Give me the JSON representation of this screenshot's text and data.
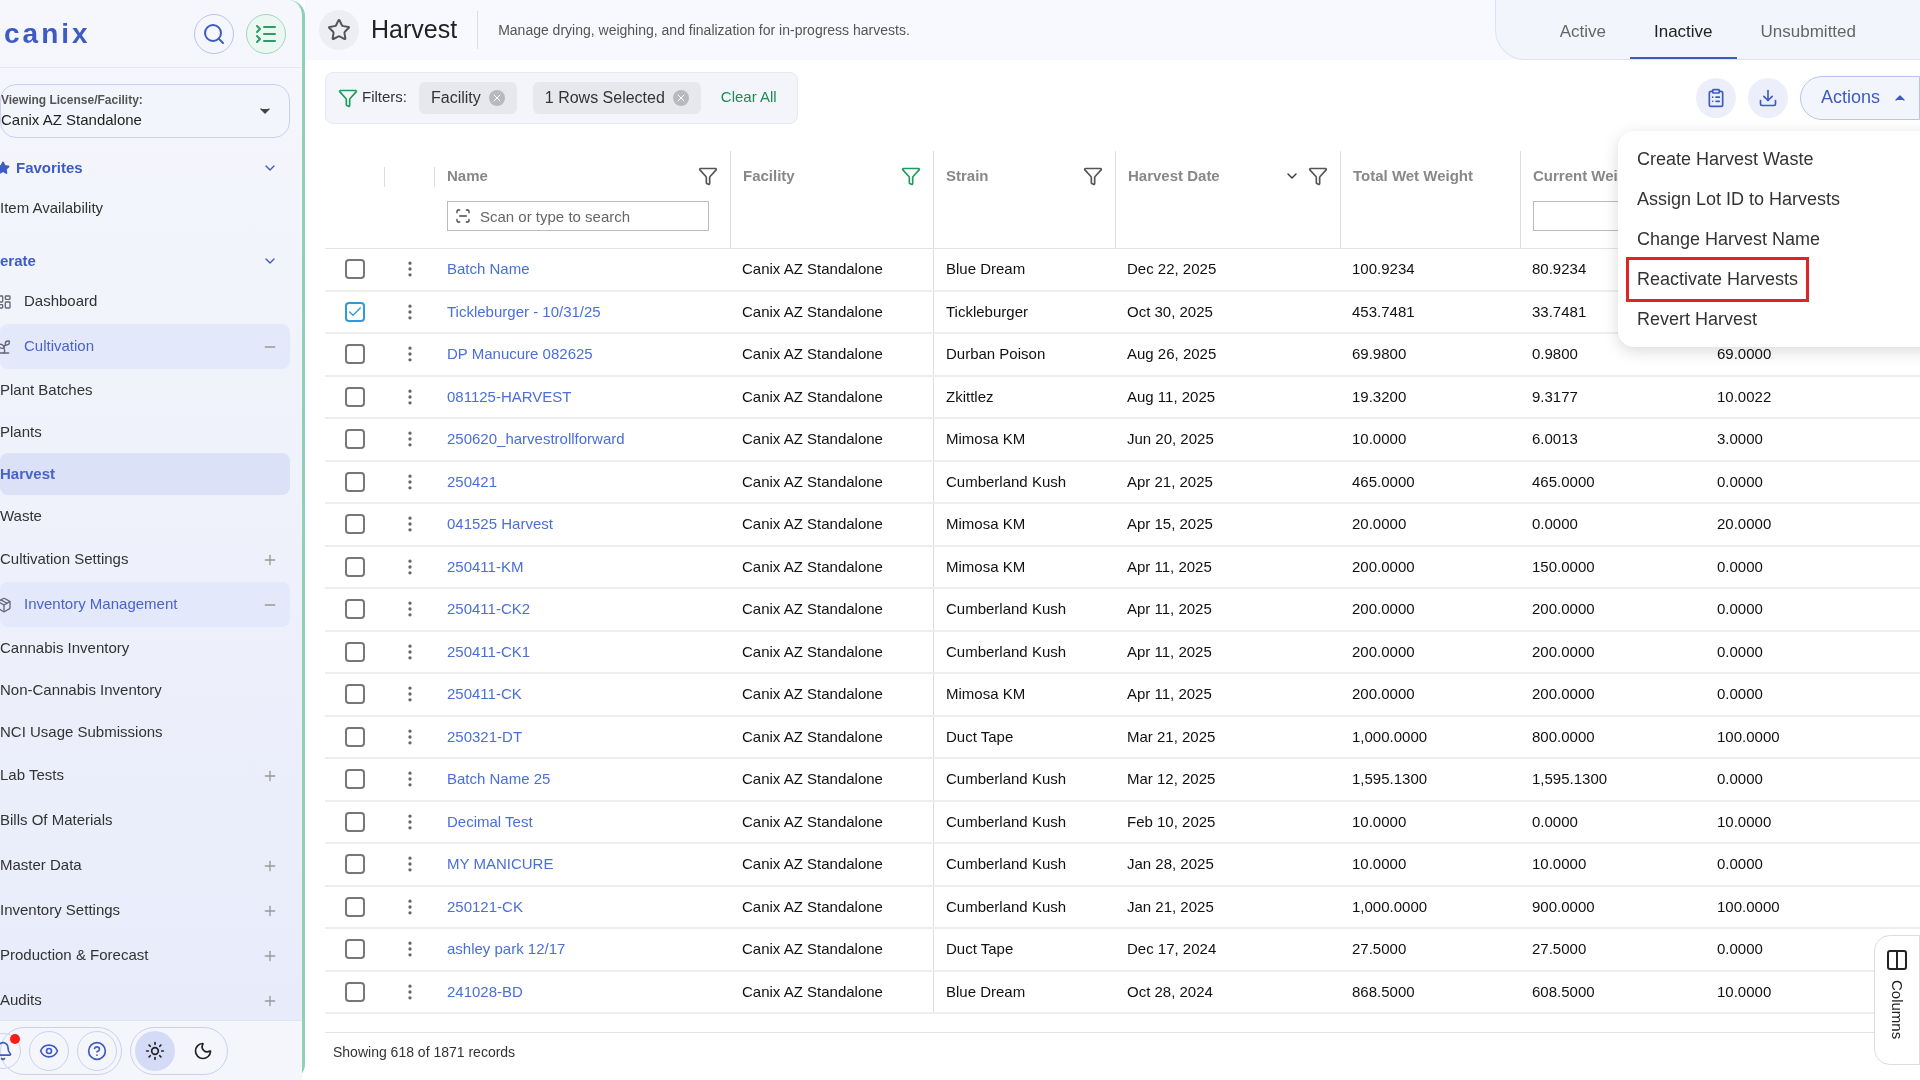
{
  "sidebar": {
    "logo": "canix",
    "license": {
      "label": "Viewing License/Facility:",
      "value": "Canix AZ Standalone"
    },
    "sections": [
      {
        "title": "Favorites",
        "expanded": true,
        "items": [
          {
            "label": "Item Availability",
            "kind": "plain"
          }
        ]
      },
      {
        "title": "erate",
        "expanded": true,
        "items": [
          {
            "label": "Dashboard",
            "kind": "link"
          },
          {
            "label": "Cultivation",
            "kind": "group",
            "expanded": true,
            "children": [
              {
                "label": "Plant Batches",
                "selected": false
              },
              {
                "label": "Plants",
                "selected": false
              },
              {
                "label": "Harvest",
                "selected": true
              },
              {
                "label": "Waste",
                "selected": false
              }
            ]
          },
          {
            "label": "Cultivation Settings",
            "kind": "group",
            "expanded": false
          },
          {
            "label": "Inventory Management",
            "kind": "group",
            "expanded": true,
            "children": [
              {
                "label": "Cannabis Inventory",
                "selected": false
              },
              {
                "label": "Non-Cannabis Inventory",
                "selected": false
              },
              {
                "label": "NCI Usage Submissions",
                "selected": false
              }
            ]
          },
          {
            "label": "Lab Tests",
            "kind": "group",
            "expanded": false
          },
          {
            "label": "Bills Of Materials",
            "kind": "plain"
          },
          {
            "label": "Master Data",
            "kind": "group",
            "expanded": false
          },
          {
            "label": "Inventory Settings",
            "kind": "group",
            "expanded": false
          },
          {
            "label": "Production & Forecast",
            "kind": "group",
            "expanded": false
          },
          {
            "label": "Audits",
            "kind": "group",
            "expanded": false
          }
        ]
      }
    ],
    "footer": {
      "notifications": true,
      "light_mode": true
    }
  },
  "header": {
    "title": "Harvest",
    "subtitle": "Manage drying, weighing, and finalization for in-progress harvests."
  },
  "tabs": [
    {
      "label": "Active",
      "selected": false
    },
    {
      "label": "Inactive",
      "selected": true
    },
    {
      "label": "Unsubmitted",
      "selected": false
    }
  ],
  "filters": {
    "label": "Filters:",
    "chips": [
      "Facility",
      "1 Rows Selected"
    ],
    "clear": "Clear All"
  },
  "actions": {
    "label": "Actions",
    "expanded": true,
    "menu": [
      {
        "label": "Create Harvest Waste",
        "highlighted": false
      },
      {
        "label": "Assign Lot ID to Harvests",
        "highlighted": false
      },
      {
        "label": "Change Harvest Name",
        "highlighted": false
      },
      {
        "label": "Reactivate Harvests",
        "highlighted": true
      },
      {
        "label": "Revert Harvest",
        "highlighted": false
      }
    ]
  },
  "table": {
    "columns": [
      {
        "label": "Name",
        "kind": "filterable",
        "filter_active": false,
        "placeholder": "Scan or type to search"
      },
      {
        "label": "Facility",
        "kind": "filterable",
        "filter_active": true
      },
      {
        "label": "Strain",
        "kind": "filterable",
        "filter_active": false
      },
      {
        "label": "Harvest Date",
        "kind": "sortable",
        "filter_active": false
      },
      {
        "label": "Total Wet Weight",
        "kind": "plain"
      },
      {
        "label": "Current Wei",
        "kind": "input"
      }
    ],
    "rows": [
      {
        "checked": false,
        "cells": [
          "Batch Name",
          "Canix AZ Standalone",
          "Blue Dream",
          "Dec 22, 2025",
          "100.9234",
          "80.9234"
        ]
      },
      {
        "checked": true,
        "cells": [
          "Tickleburger - 10/31/25",
          "Canix AZ Standalone",
          "Tickleburger",
          "Oct 30, 2025",
          "453.7481",
          "33.7481"
        ]
      },
      {
        "checked": false,
        "cells": [
          "DP Manucure 082625",
          "Canix AZ Standalone",
          "Durban Poison",
          "Aug 26, 2025",
          "69.9800",
          "0.9800",
          "69.0000"
        ]
      },
      {
        "checked": false,
        "cells": [
          "081125-HARVEST",
          "Canix AZ Standalone",
          "Zkittlez",
          "Aug 11, 2025",
          "19.3200",
          "9.3177",
          "10.0022"
        ]
      },
      {
        "checked": false,
        "cells": [
          "250620_harvestrollforward",
          "Canix AZ Standalone",
          "Mimosa KM",
          "Jun 20, 2025",
          "10.0000",
          "6.0013",
          "3.0000"
        ]
      },
      {
        "checked": false,
        "cells": [
          "250421",
          "Canix AZ Standalone",
          "Cumberland Kush",
          "Apr 21, 2025",
          "465.0000",
          "465.0000",
          "0.0000"
        ]
      },
      {
        "checked": false,
        "cells": [
          "041525 Harvest",
          "Canix AZ Standalone",
          "Mimosa KM",
          "Apr 15, 2025",
          "20.0000",
          "0.0000",
          "20.0000"
        ]
      },
      {
        "checked": false,
        "cells": [
          "250411-KM",
          "Canix AZ Standalone",
          "Mimosa KM",
          "Apr 11, 2025",
          "200.0000",
          "150.0000",
          "0.0000"
        ]
      },
      {
        "checked": false,
        "cells": [
          "250411-CK2",
          "Canix AZ Standalone",
          "Cumberland Kush",
          "Apr 11, 2025",
          "200.0000",
          "200.0000",
          "0.0000"
        ]
      },
      {
        "checked": false,
        "cells": [
          "250411-CK1",
          "Canix AZ Standalone",
          "Cumberland Kush",
          "Apr 11, 2025",
          "200.0000",
          "200.0000",
          "0.0000"
        ]
      },
      {
        "checked": false,
        "cells": [
          "250411-CK",
          "Canix AZ Standalone",
          "Mimosa KM",
          "Apr 11, 2025",
          "200.0000",
          "200.0000",
          "0.0000"
        ]
      },
      {
        "checked": false,
        "cells": [
          "250321-DT",
          "Canix AZ Standalone",
          "Duct Tape",
          "Mar 21, 2025",
          "1,000.0000",
          "800.0000",
          "100.0000"
        ]
      },
      {
        "checked": false,
        "cells": [
          "Batch Name 25",
          "Canix AZ Standalone",
          "Cumberland Kush",
          "Mar 12, 2025",
          "1,595.1300",
          "1,595.1300",
          "0.0000"
        ]
      },
      {
        "checked": false,
        "cells": [
          "Decimal Test",
          "Canix AZ Standalone",
          "Cumberland Kush",
          "Feb 10, 2025",
          "10.0000",
          "0.0000",
          "10.0000"
        ]
      },
      {
        "checked": false,
        "cells": [
          "MY MANICURE",
          "Canix AZ Standalone",
          "Cumberland Kush",
          "Jan 28, 2025",
          "10.0000",
          "10.0000",
          "0.0000"
        ]
      },
      {
        "checked": false,
        "cells": [
          "250121-CK",
          "Canix AZ Standalone",
          "Cumberland Kush",
          "Jan 21, 2025",
          "1,000.0000",
          "900.0000",
          "100.0000"
        ]
      },
      {
        "checked": false,
        "cells": [
          "ashley park 12/17",
          "Canix AZ Standalone",
          "Duct Tape",
          "Dec 17, 2024",
          "27.5000",
          "27.5000",
          "0.0000"
        ]
      },
      {
        "checked": false,
        "cells": [
          "241028-BD",
          "Canix AZ Standalone",
          "Blue Dream",
          "Oct 28, 2024",
          "868.5000",
          "608.5000",
          "10.0000"
        ]
      }
    ],
    "footer": "Showing 618 of 1871 records",
    "columns_panel": "Columns"
  }
}
